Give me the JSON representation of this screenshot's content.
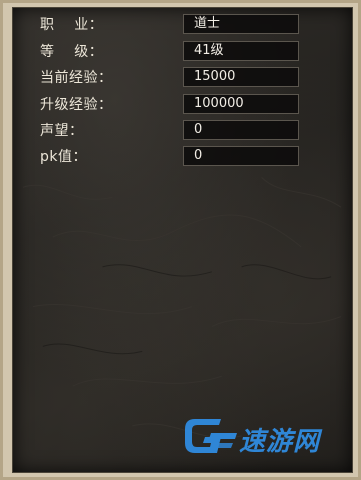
{
  "stats": [
    {
      "label": "职    业：",
      "value": "道士"
    },
    {
      "label": "等    级：",
      "value": "41级"
    },
    {
      "label": "当前经验：",
      "value": "15000"
    },
    {
      "label": "升级经验：",
      "value": "100000"
    },
    {
      "label": "声望：",
      "value": "0"
    },
    {
      "label": "pk值：",
      "value": "0"
    }
  ],
  "watermark": {
    "text": "速游网",
    "icon": "speed-g-logo-icon"
  },
  "colors": {
    "label": "#ece6d8",
    "value_bg": "#0c0b0a",
    "value_border": "#5b564e",
    "watermark": "#2f86d6",
    "frame": "#b4a587"
  }
}
